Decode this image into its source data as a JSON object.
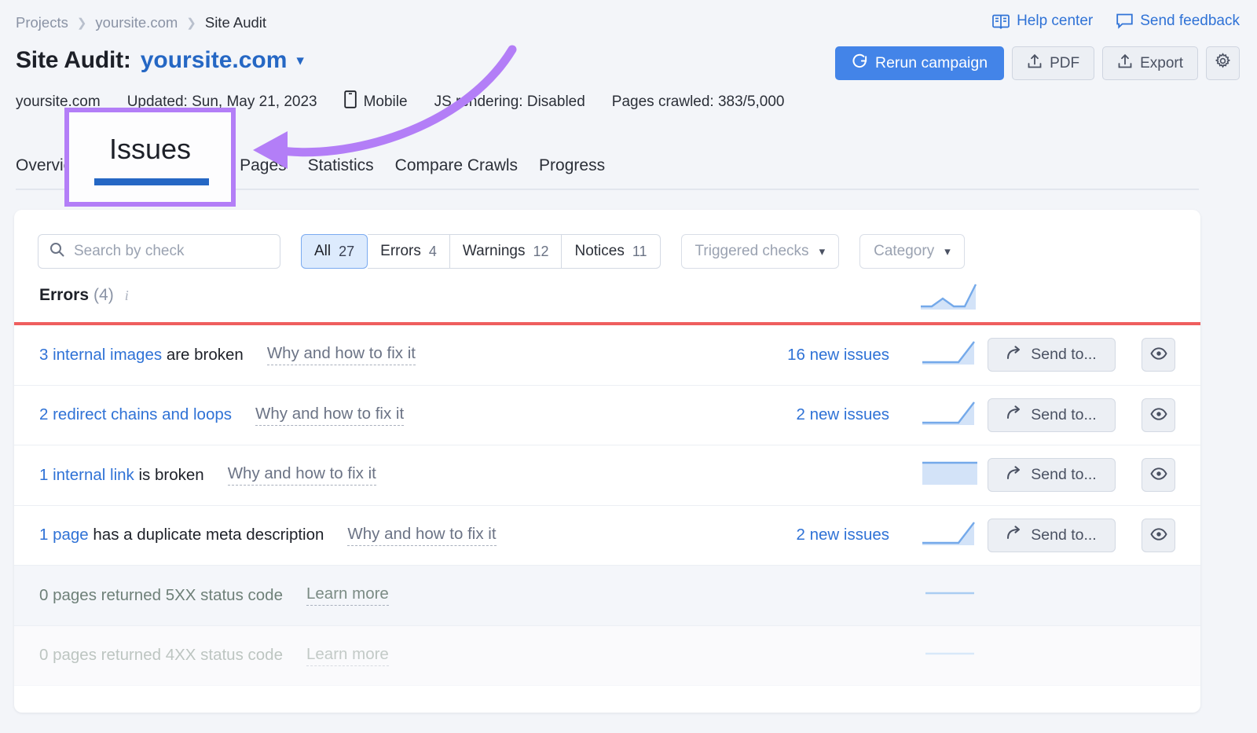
{
  "breadcrumb": [
    {
      "label": "Projects",
      "current": false
    },
    {
      "label": "yoursite.com",
      "current": false
    },
    {
      "label": "Site Audit",
      "current": true
    }
  ],
  "toplinks": [
    {
      "label": "Help center",
      "icon": "book-icon"
    },
    {
      "label": "Send feedback",
      "icon": "speech-bubble-icon"
    }
  ],
  "header": {
    "title_prefix": "Site Audit:",
    "project": "yoursite.com",
    "caret": "⌄"
  },
  "actions": {
    "rerun_label": "Rerun campaign",
    "pdf_label": "PDF",
    "export_label": "Export",
    "settings_icon": "gear-icon"
  },
  "meta": {
    "domain": "yoursite.com",
    "updated": "Updated: Sun, May 21, 2023",
    "device": "Mobile",
    "js_rendering": "JS rendering: Disabled",
    "pages_crawled": "Pages crawled: 383/5,000"
  },
  "tabs": [
    {
      "label": "Overview",
      "active": false
    },
    {
      "label": "Issues",
      "active": true
    },
    {
      "label": "Crawled Pages",
      "active": false
    },
    {
      "label": "Statistics",
      "active": false
    },
    {
      "label": "Compare Crawls",
      "active": false
    },
    {
      "label": "Progress",
      "active": false
    }
  ],
  "search": {
    "placeholder": "Search by check",
    "value": ""
  },
  "segments": [
    {
      "label": "All",
      "count": "27",
      "active": true
    },
    {
      "label": "Errors",
      "count": "4",
      "active": false
    },
    {
      "label": "Warnings",
      "count": "12",
      "active": false
    },
    {
      "label": "Notices",
      "count": "11",
      "active": false
    }
  ],
  "dropdowns": [
    {
      "label": "Triggered checks"
    },
    {
      "label": "Category"
    }
  ],
  "section": {
    "label": "Errors",
    "count": "(4)",
    "info_icon": "info-icon",
    "accent_color": "#ef5e5e"
  },
  "rows": [
    {
      "link_text": "3 internal images",
      "rest_text": " are broken",
      "fix_label": "Why and how to fix it",
      "new_issues": "16 new issues",
      "send_label": "Send to...",
      "eye_icon": "eye-icon",
      "muted": false,
      "faded": false
    },
    {
      "link_text": "2 redirect chains and loops",
      "rest_text": "",
      "fix_label": "Why and how to fix it",
      "new_issues": "2 new issues",
      "send_label": "Send to...",
      "eye_icon": "eye-icon",
      "muted": false,
      "faded": false
    },
    {
      "link_text": "1 internal link",
      "rest_text": " is broken",
      "fix_label": "Why and how to fix it",
      "new_issues": "",
      "send_label": "Send to...",
      "eye_icon": "eye-icon",
      "muted": false,
      "faded": false
    },
    {
      "link_text": "1 page",
      "rest_text": " has a duplicate meta description",
      "fix_label": "Why and how to fix it",
      "new_issues": "2 new issues",
      "send_label": "Send to...",
      "eye_icon": "eye-icon",
      "muted": false,
      "faded": false
    },
    {
      "link_text": "0 pages returned 5XX status code",
      "rest_text": "",
      "fix_label": "Learn more",
      "new_issues": "",
      "send_label": "",
      "eye_icon": "",
      "muted": true,
      "faded": false
    },
    {
      "link_text": "0 pages returned 4XX status code",
      "rest_text": "",
      "fix_label": "Learn more",
      "new_issues": "",
      "send_label": "",
      "eye_icon": "",
      "muted": true,
      "faded": true
    }
  ],
  "annotation": {
    "label": "Issues",
    "color": "#b37ef7",
    "points_to": "Issues tab"
  },
  "chart_data": [
    {
      "type": "area",
      "name": "errors-section-sparkline",
      "x": [
        0,
        1,
        2,
        3,
        4,
        5,
        6
      ],
      "values": [
        20,
        20,
        34,
        20,
        20,
        20,
        86
      ],
      "ylim": [
        0,
        100
      ],
      "title": "",
      "xlabel": "",
      "ylabel": "",
      "grid": false,
      "legend": "none"
    },
    {
      "type": "area",
      "name": "row-1-sparkline",
      "x": [
        0,
        1,
        2,
        3,
        4
      ],
      "values": [
        16,
        16,
        16,
        16,
        92
      ],
      "ylim": [
        0,
        100
      ],
      "title": "",
      "xlabel": "",
      "ylabel": "",
      "grid": false,
      "legend": "none"
    },
    {
      "type": "area",
      "name": "row-2-sparkline",
      "x": [
        0,
        1,
        2,
        3,
        4
      ],
      "values": [
        16,
        16,
        16,
        16,
        92
      ],
      "ylim": [
        0,
        100
      ],
      "title": "",
      "xlabel": "",
      "ylabel": "",
      "grid": false,
      "legend": "none"
    },
    {
      "type": "area",
      "name": "row-3-sparkline",
      "x": [
        0,
        1,
        2,
        3,
        4
      ],
      "values": [
        88,
        88,
        88,
        88,
        88
      ],
      "ylim": [
        0,
        100
      ],
      "title": "",
      "xlabel": "",
      "ylabel": "",
      "grid": false,
      "legend": "none"
    },
    {
      "type": "area",
      "name": "row-4-sparkline",
      "x": [
        0,
        1,
        2,
        3,
        4
      ],
      "values": [
        16,
        16,
        16,
        16,
        92
      ],
      "ylim": [
        0,
        100
      ],
      "title": "",
      "xlabel": "",
      "ylabel": "",
      "grid": false,
      "legend": "none"
    },
    {
      "type": "line",
      "name": "row-5-sparkline",
      "x": [
        0,
        1
      ],
      "values": [
        50,
        50
      ],
      "ylim": [
        0,
        100
      ],
      "title": "",
      "xlabel": "",
      "ylabel": "",
      "grid": false,
      "legend": "none"
    }
  ]
}
